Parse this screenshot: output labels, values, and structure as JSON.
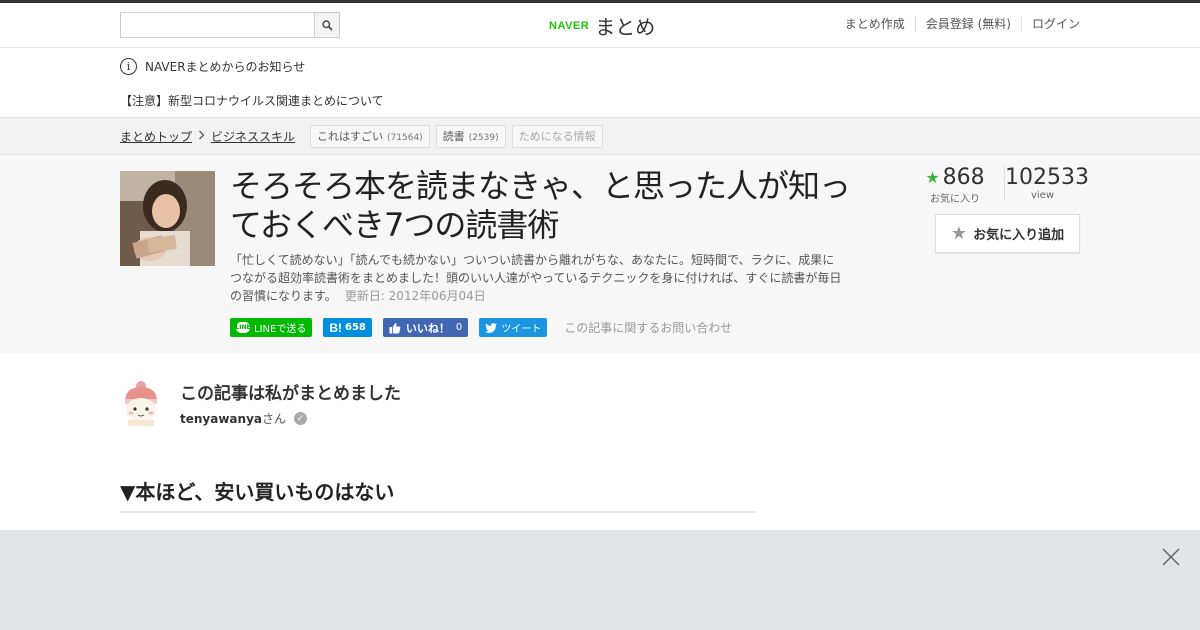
{
  "header": {
    "search_placeholder": "",
    "logo_brand": "NAVER",
    "logo_name": "まとめ",
    "links": [
      "まとめ作成",
      "会員登録 (無料)",
      "ログイン"
    ]
  },
  "notice": {
    "title": "NAVERまとめからのお知らせ",
    "item": "【注意】新型コロナウイルス関連まとめについて"
  },
  "breadcrumb": {
    "home": "まとめトップ",
    "category": "ビジネススキル",
    "tags": [
      {
        "label": "これはすごい",
        "count": "(71564)"
      },
      {
        "label": "読書",
        "count": "(2539)"
      },
      {
        "label": "ためになる情報",
        "count": ""
      }
    ]
  },
  "article": {
    "title": "そろそろ本を読まなきゃ、と思った人が知っておくべき7つの読書術",
    "description": "「忙しくて読めない」「読んでも続かない」ついつい読書から離れがちな、あなたに。短時間で、ラクに、成果につながる超効率読書術をまとめました！頭のいい人達がやっているテクニックを身に付ければ、すぐに読書が毎日の習慣になります。",
    "updated": "更新日: 2012年06月04日",
    "share": {
      "line": "LINEで送る",
      "hatena_count": "658",
      "fb_label": "いいね！",
      "fb_count": "0",
      "tweet": "ツイート",
      "inquiry": "この記事に関するお問い合わせ"
    },
    "favorites": "868",
    "favorites_label": "お気に入り",
    "views": "102533",
    "views_label": "view",
    "fav_button": "お気に入り追加"
  },
  "author": {
    "heading": "この記事は私がまとめました",
    "username": "tenyawanya",
    "suffix": "さん"
  },
  "section": {
    "heading": "▼本ほど、安い買いものはない"
  },
  "colors": {
    "naver_green": "#1ec800",
    "line_green": "#00b900",
    "hatena_blue": "#008fde",
    "fb_blue": "#4267b2",
    "twitter_blue": "#1b95e0",
    "star_green": "#3cb43c"
  }
}
